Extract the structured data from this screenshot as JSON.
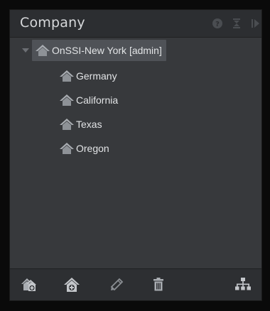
{
  "panel": {
    "title": "Company",
    "header_icons": [
      "help-icon",
      "collapse-icon",
      "undock-icon"
    ]
  },
  "tree": {
    "root": {
      "label": "OnSSI-New York [admin]",
      "icon": "house-icon",
      "expanded": true,
      "selected": true
    },
    "children": [
      {
        "label": "Germany",
        "icon": "house-icon"
      },
      {
        "label": "California",
        "icon": "house-icon"
      },
      {
        "label": "Texas",
        "icon": "house-icon"
      },
      {
        "label": "Oregon",
        "icon": "house-icon"
      }
    ]
  },
  "toolbar": {
    "buttons": [
      "add-sites-icon",
      "add-site-icon",
      "edit-icon",
      "delete-icon",
      "hierarchy-icon"
    ]
  },
  "colors": {
    "panel_bg": "#37393c",
    "header_bg": "#2c2e31",
    "selected_bg": "#4f5257",
    "icon_gray": "#a9adb2",
    "text": "#e2e4e6"
  }
}
